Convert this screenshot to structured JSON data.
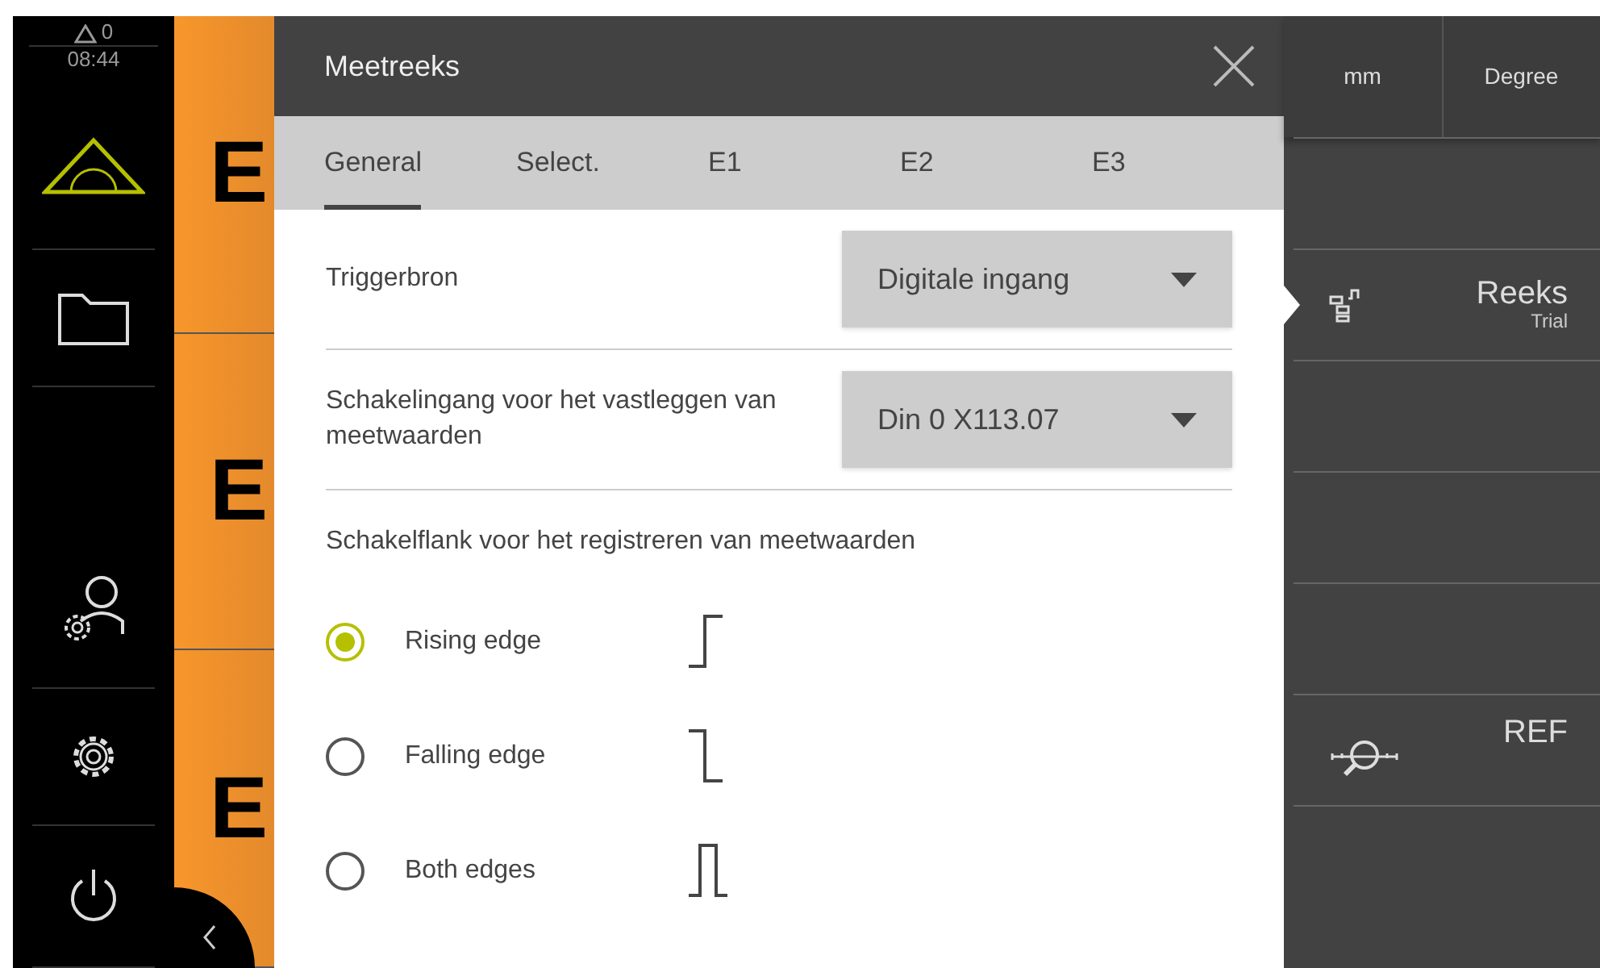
{
  "status": {
    "warnings": "0",
    "time": "08:44"
  },
  "sidebar": {
    "items": [
      {
        "kind": "measure",
        "selected": true
      },
      {
        "kind": "folder",
        "selected": false
      },
      {
        "kind": "user",
        "selected": false
      },
      {
        "kind": "settings",
        "selected": false
      },
      {
        "kind": "power",
        "selected": false
      }
    ]
  },
  "entries": [
    {
      "label": "E"
    },
    {
      "label": "E"
    },
    {
      "label": "E"
    }
  ],
  "dialog": {
    "title": "Meetreeks",
    "tabs": [
      {
        "label": "General",
        "selected": true
      },
      {
        "label": "Select.",
        "selected": false
      },
      {
        "label": "E1",
        "selected": false
      },
      {
        "label": "E2",
        "selected": false
      },
      {
        "label": "E3",
        "selected": false
      }
    ],
    "fields": [
      {
        "label": "Triggerbron",
        "value": "Digitale ingang"
      },
      {
        "label": "Schakelingang voor het vastleggen van meetwaarden",
        "value": "Din 0 X113.07"
      }
    ],
    "edge_group": {
      "label": "Schakelflank voor het registreren van meetwaarden",
      "options": [
        {
          "label": "Rising edge",
          "kind": "rising",
          "selected": true
        },
        {
          "label": "Falling edge",
          "kind": "falling",
          "selected": false
        },
        {
          "label": "Both edges",
          "kind": "both",
          "selected": false
        }
      ]
    }
  },
  "right_panel": {
    "units": [
      {
        "label": "mm"
      },
      {
        "label": "Degree"
      }
    ],
    "rows": [
      {
        "kind": "empty"
      },
      {
        "kind": "series",
        "title": "Reeks",
        "subtitle": "Trial",
        "selected": true
      },
      {
        "kind": "empty"
      },
      {
        "kind": "empty"
      },
      {
        "kind": "empty"
      },
      {
        "kind": "ref",
        "title": "REF"
      },
      {
        "kind": "empty"
      }
    ]
  }
}
